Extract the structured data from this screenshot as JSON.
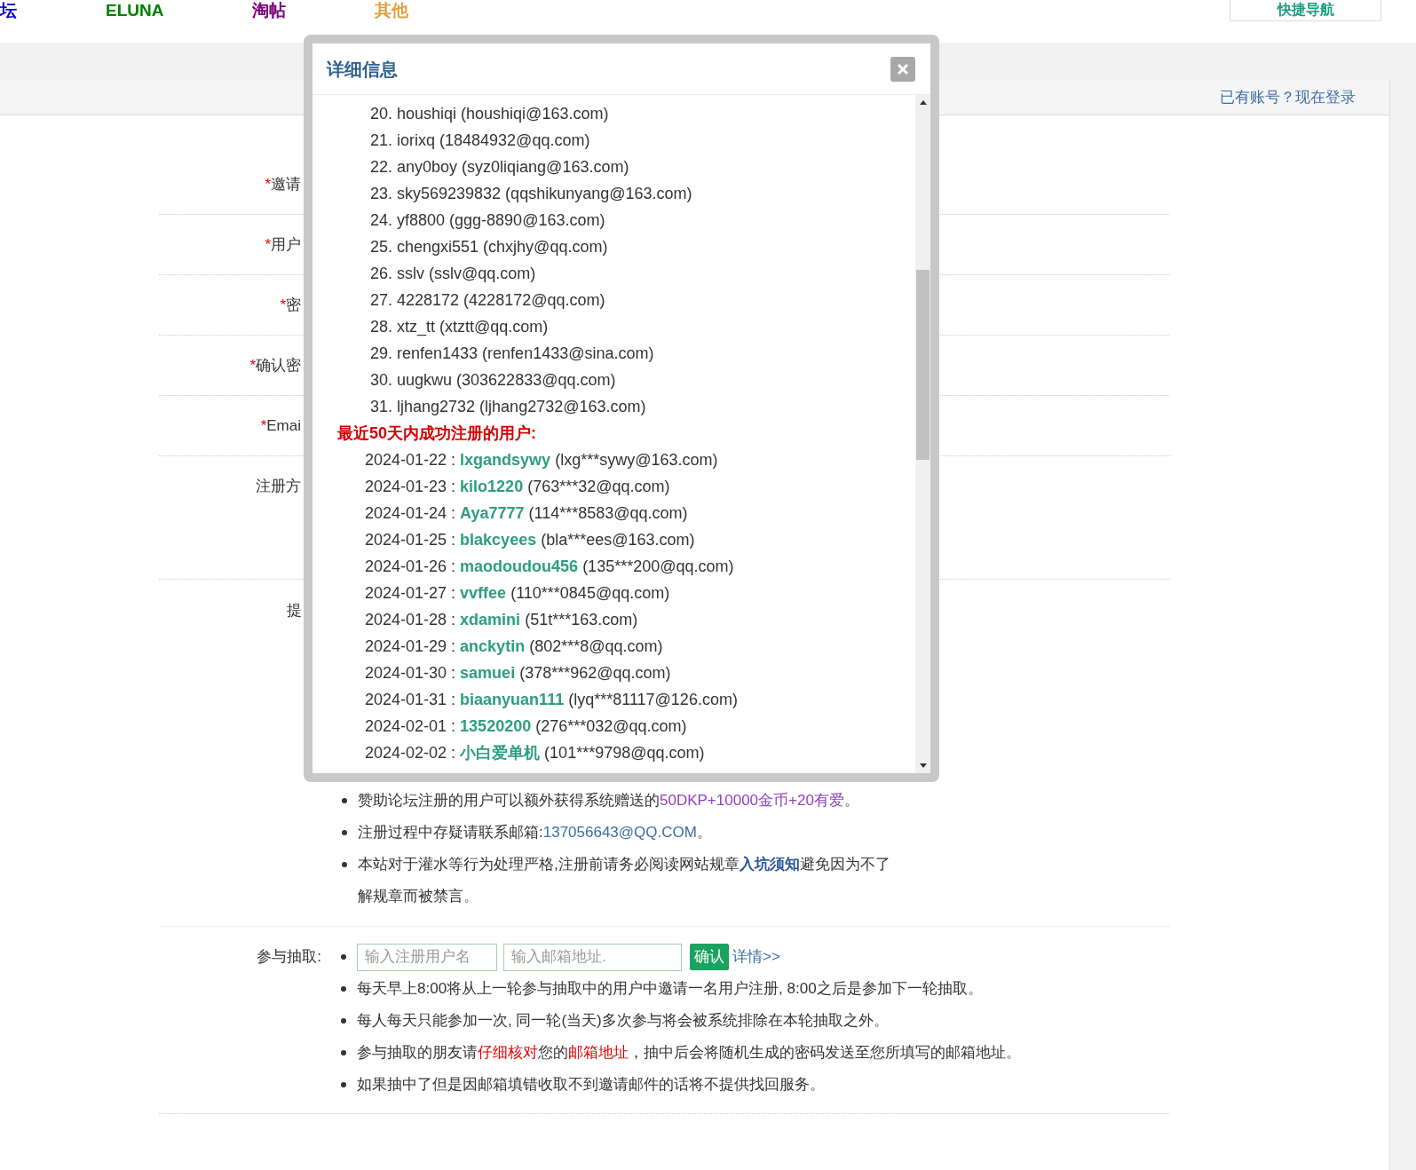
{
  "top_nav": {
    "items": [
      {
        "label": "坛",
        "color": "#0000cc"
      },
      {
        "label": "ELUNA",
        "color": "#008000"
      },
      {
        "label": "淘帖",
        "color": "#800080"
      },
      {
        "label": "其他",
        "color": "#e0a040"
      }
    ],
    "quick_nav_button": "快捷导航"
  },
  "login_prompt": "已有账号？现在登录",
  "form": {
    "rows": [
      {
        "marker": "*",
        "label": "邀请",
        "kind": "field"
      },
      {
        "marker": "*",
        "label": "用户",
        "kind": "field"
      },
      {
        "marker": "*",
        "label": "密",
        "kind": "field"
      },
      {
        "marker": "*",
        "label": "确认密",
        "kind": "field"
      },
      {
        "marker": "*",
        "label": "Emai",
        "kind": "field"
      },
      {
        "label": "注册方",
        "kind": "choice"
      }
    ]
  },
  "tips": {
    "label": "提",
    "items": [
      [
        {
          "kind": "text",
          "text": "赞助论坛注册的用户可以额外获得系统赠送的"
        },
        {
          "kind": "highlight",
          "text": "50DKP+10000金币+20有爱"
        },
        {
          "kind": "text",
          "text": "。"
        }
      ],
      [
        {
          "kind": "text",
          "text": "注册过程中存疑请联系邮箱:"
        },
        {
          "kind": "link",
          "text": "137056643@QQ.COM"
        },
        {
          "kind": "text",
          "text": "。"
        }
      ],
      [
        {
          "kind": "text",
          "text": "本站对于灌水等行为处理严格,注册前请务必阅读网站规章"
        },
        {
          "kind": "strong_link",
          "text": "入坑须知"
        },
        {
          "kind": "text",
          "text": "避免因为不了解规章而被禁言。"
        }
      ]
    ]
  },
  "draw": {
    "label": "参与抽取:",
    "username_placeholder": "输入注册用户名",
    "email_placeholder": "输入邮箱地址.",
    "confirm_button": "确认",
    "details_link": "详情>>",
    "items": [
      [
        {
          "kind": "text",
          "text": "每天早上8:00将从上一轮参与抽取中的用户中邀请一名用户注册, 8:00之后是参加下一轮抽取。"
        }
      ],
      [
        {
          "kind": "text",
          "text": "每人每天只能参加一次, 同一轮(当天)多次参与将会被系统排除在本轮抽取之外。"
        }
      ],
      [
        {
          "kind": "text",
          "text": "参与抽取的朋友请"
        },
        {
          "kind": "warning",
          "text": "仔细核对"
        },
        {
          "kind": "text",
          "text": "您的"
        },
        {
          "kind": "warning",
          "text": "邮箱地址"
        },
        {
          "kind": "text",
          "text": "，抽中后会将随机生成的密码发送至您所填写的邮箱地址。"
        }
      ],
      [
        {
          "kind": "text",
          "text": "如果抽中了但是因邮箱填错收取不到邀请邮件的话将不提供找回服务。"
        }
      ]
    ]
  },
  "dialog": {
    "title": "详细信息",
    "invited_users": [
      "20. houshiqi (houshiqi@163.com)",
      "21. iorixq (18484932@qq.com)",
      "22. any0boy (syz0liqiang@163.com)",
      "23. sky569239832 (qqshikunyang@163.com)",
      "24. yf8800 (ggg-8890@163.com)",
      "25. chengxi551 (chxjhy@qq.com)",
      "26. sslv (sslv@qq.com)",
      "27. 4228172 (4228172@qq.com)",
      "28. xtz_tt (xtztt@qq.com)",
      "29. renfen1433 (renfen1433@sina.com)",
      "30. uugkwu (303622833@qq.com)",
      "31. ljhang2732 (ljhang2732@163.com)"
    ],
    "recent_heading": "最近50天内成功注册的用户:",
    "recent_users": [
      {
        "date": "2024-01-22 :",
        "username": "lxgandsywy",
        "email": "(lxg***sywy@163.com)"
      },
      {
        "date": "2024-01-23 :",
        "username": "kilo1220",
        "email": "(763***32@qq.com)"
      },
      {
        "date": "2024-01-24 :",
        "username": "Aya7777",
        "email": "(114***8583@qq.com)"
      },
      {
        "date": "2024-01-25 :",
        "username": "blakcyees",
        "email": "(bla***ees@163.com)"
      },
      {
        "date": "2024-01-26 :",
        "username": "maodoudou456",
        "email": "(135***200@qq.com)"
      },
      {
        "date": "2024-01-27 :",
        "username": "vvffee",
        "email": "(110***0845@qq.com)"
      },
      {
        "date": "2024-01-28 :",
        "username": "xdamini",
        "email": "(51t***163.com)"
      },
      {
        "date": "2024-01-29 :",
        "username": "anckytin",
        "email": "(802***8@qq.com)"
      },
      {
        "date": "2024-01-30 :",
        "username": "samuei",
        "email": "(378***962@qq.com)"
      },
      {
        "date": "2024-01-31 :",
        "username": "biaanyuan111",
        "email": "(lyq***81117@126.com)"
      },
      {
        "date": "2024-02-01 :",
        "username": "13520200",
        "email": "(276***032@qq.com)"
      },
      {
        "date": "2024-02-02 :",
        "username": "小白爱单机",
        "email": "(101***9798@qq.com)"
      }
    ]
  }
}
